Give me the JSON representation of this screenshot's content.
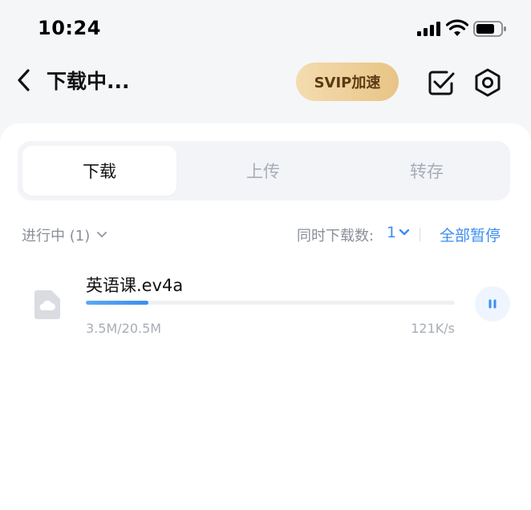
{
  "status_bar": {
    "time": "10:24"
  },
  "header": {
    "title": "下载中...",
    "svip_label": "SVIP加速"
  },
  "tabs": [
    {
      "label": "下载",
      "active": true
    },
    {
      "label": "上传",
      "active": false
    },
    {
      "label": "转存",
      "active": false
    }
  ],
  "toolbar": {
    "filter_label": "进行中 (1)",
    "concurrent_label": "同时下载数:",
    "concurrent_value": "1",
    "pause_all_label": "全部暂停"
  },
  "downloads": [
    {
      "name": "英语课.ev4a",
      "size": "3.5M/20.5M",
      "speed": "121K/s",
      "progress": 0.17
    }
  ],
  "colors": {
    "accent": "#3b8ef0",
    "svip_gradient_start": "#f4dcb0",
    "svip_gradient_end": "#e8c485",
    "muted": "#a8adb6"
  },
  "icons": {
    "back": "back-chevron-icon",
    "check": "checkbox-icon",
    "settings": "settings-icon",
    "file": "cloud-file-icon",
    "pause": "pause-icon"
  }
}
